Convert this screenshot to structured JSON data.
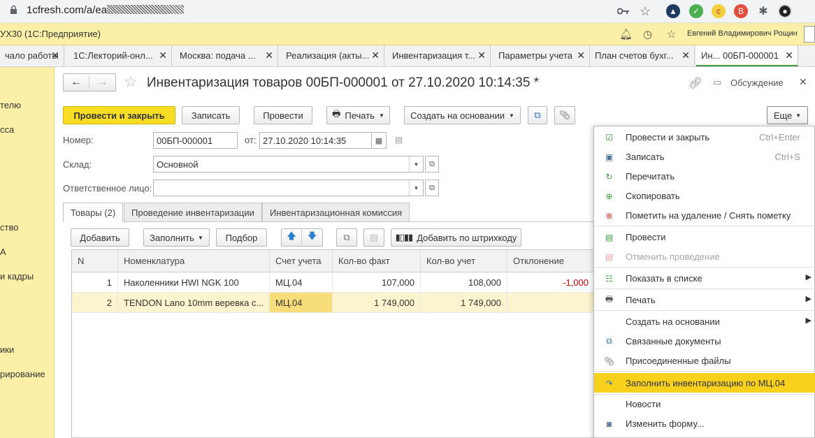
{
  "browser": {
    "url_visible": "1cfresh.com/a/ea",
    "icons": [
      "key-icon",
      "star-icon",
      "ext-1-icon",
      "ext-2-icon",
      "ext-3-icon",
      "ext-4-icon",
      "puzzle-icon",
      "avatar"
    ]
  },
  "topline": {
    "app_title": "УХ30  (1С:Предприятие)",
    "user": "Евгений Владимирович Рощин"
  },
  "tabs": [
    {
      "label": "чало работы"
    },
    {
      "label": "1С:Лекторий-онл..."
    },
    {
      "label": "Москва: подача ..."
    },
    {
      "label": "Реализация (акты..."
    },
    {
      "label": "Инвентаризация т..."
    },
    {
      "label": "Параметры учета"
    },
    {
      "label": "План счетов бухг..."
    },
    {
      "label": "Ин...   00БП-000001"
    }
  ],
  "sidebar": [
    "телю",
    "сса",
    "ство",
    "А",
    "и кадры",
    "ики",
    "рирование"
  ],
  "form": {
    "title": "Инвентаризация товаров 00БП-000001 от 27.10.2020 10:14:35 *",
    "discussion": "Обсуждение",
    "buttons": {
      "post_close": "Провести и закрыть",
      "save": "Записать",
      "post": "Провести",
      "print": "Печать",
      "create_based": "Создать на основании",
      "more": "Еще"
    },
    "number_label": "Номер:",
    "number_value": "00БП-000001",
    "date_label": "от:",
    "date_value": "27.10.2020 10:14:35",
    "warehouse_label": "Склад:",
    "warehouse_value": "Основной",
    "responsible_label": "Ответственное лицо:",
    "responsible_value": ""
  },
  "form_tabs": [
    "Товары (2)",
    "Проведение инвентаризации",
    "Инвентаризационная комиссия"
  ],
  "table_toolbar": {
    "add": "Добавить",
    "fill": "Заполнить",
    "pick": "Подбор",
    "barcode": "Добавить по штрихкоду"
  },
  "table": {
    "headers": [
      "N",
      "Номенклатура",
      "Счет учета",
      "Кол-во факт",
      "Кол-во учет",
      "Отклонение"
    ],
    "rows": [
      [
        "1",
        "Наколенники HWI NGK 100",
        "МЦ.04",
        "107,000",
        "108,000",
        "-1,000"
      ],
      [
        "2",
        "TENDON Lano 10mm веревка с...",
        "МЦ.04",
        "1 749,000",
        "1 749,000",
        ""
      ]
    ]
  },
  "menu": [
    {
      "label": "Провести и закрыть",
      "shortcut": "Ctrl+Enter",
      "icon": "post-close-icon"
    },
    {
      "label": "Записать",
      "shortcut": "Ctrl+S",
      "icon": "save-icon"
    },
    {
      "label": "Перечитать",
      "icon": "reload-icon"
    },
    {
      "label": "Скопировать",
      "icon": "copy-icon"
    },
    {
      "label": "Пометить на удаление / Снять пометку",
      "icon": "delete-mark-icon"
    },
    {
      "label": "Провести",
      "icon": "post-icon"
    },
    {
      "label": "Отменить проведение",
      "icon": "unpost-icon"
    },
    {
      "label": "Показать в списке",
      "icon": "list-icon"
    },
    {
      "label": "Печать",
      "icon": "print-icon"
    },
    {
      "label": "Создать на основании"
    },
    {
      "label": "Связанные документы",
      "icon": "related-docs-icon"
    },
    {
      "label": "Присоединенные файлы",
      "icon": "attach-icon"
    },
    {
      "label": "Заполнить инвентаризацию по МЦ.04",
      "icon": "fill-arrow-icon"
    },
    {
      "label": "Новости"
    },
    {
      "label": "Изменить форму...",
      "icon": "form-settings-icon"
    }
  ],
  "colors": {
    "accent_yellow": "#f7dd23",
    "panel_yellow": "#fcf0a8",
    "highlight": "#f7d11b",
    "negative": "#d40000"
  }
}
